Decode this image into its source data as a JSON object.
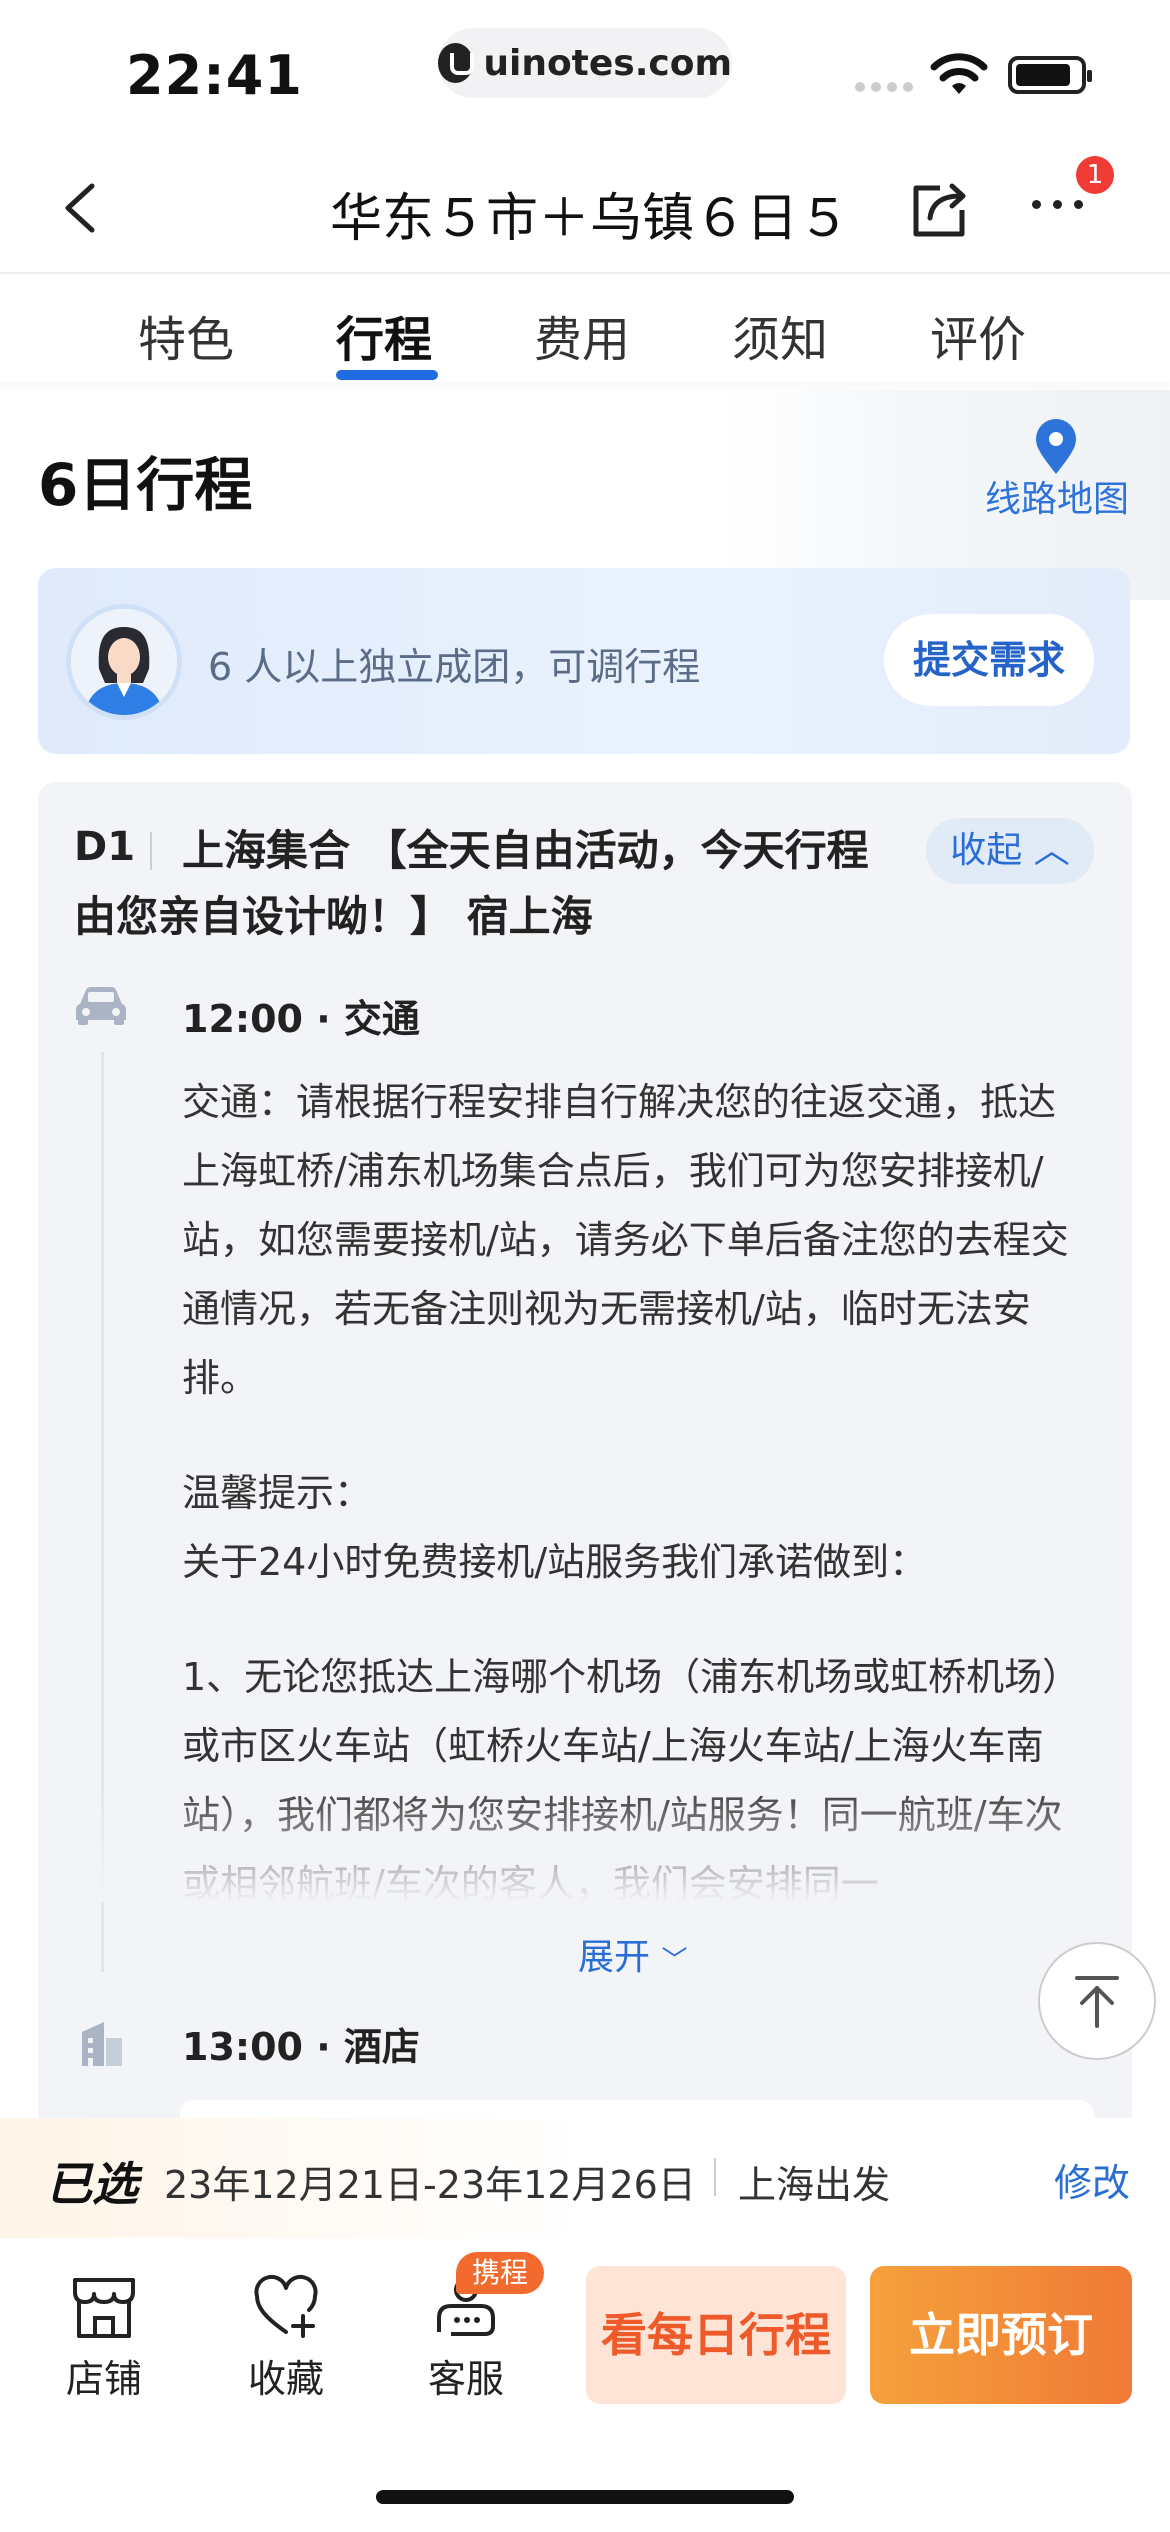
{
  "status": {
    "time": "22:41",
    "url": "uinotes.com"
  },
  "nav": {
    "title": "华东５市＋乌镇６日５...",
    "badge": "1"
  },
  "tabs": [
    "特色",
    "行程",
    "费用",
    "须知",
    "评价"
  ],
  "section": {
    "title": "6日行程",
    "map_label": "线路地图"
  },
  "banner": {
    "text": "6 人以上独立成团，可调行程",
    "button": "提交需求"
  },
  "day": {
    "label": "D1",
    "title": "上海集合 【全天自由活动，今天行程由您亲自设计呦！】 宿上海",
    "collapse": "收起",
    "event1_time": "12:00 · 交通",
    "para1": "交通：请根据行程安排自行解决您的往返交通，抵达上海虹桥/浦东机场集合点后，我们可为您安排接机/站，如您需要接机/站，请务必下单后备注您的去程交通情况，若无备注则视为无需接机/站，临时无法安排。",
    "tip1": "温馨提示：",
    "tip2": "关于24小时免费接机/站服务我们承诺做到：",
    "para2": "1、无论您抵达上海哪个机场（浦东机场或虹桥机场）或市区火车站（虹桥火车站/上海火车站/上海火车南站），我们都将为您安排接机/站服务！同一航班/车次或相邻航班/车次的客人，我们会安排同一",
    "expand": "展开",
    "event2_time": "13:00 · 酒店"
  },
  "selected": {
    "label": "已选",
    "dates": "23年12月21日-23年12月26日",
    "from": "上海出发",
    "modify": "修改"
  },
  "bottom": {
    "store": "店铺",
    "fav": "收藏",
    "service": "客服",
    "service_badge": "携程",
    "daily": "看每日行程",
    "book": "立即预订"
  },
  "colors": {
    "accent": "#1f6ce0",
    "book": "#f07a36",
    "daily_bg": "#fde4d7"
  }
}
